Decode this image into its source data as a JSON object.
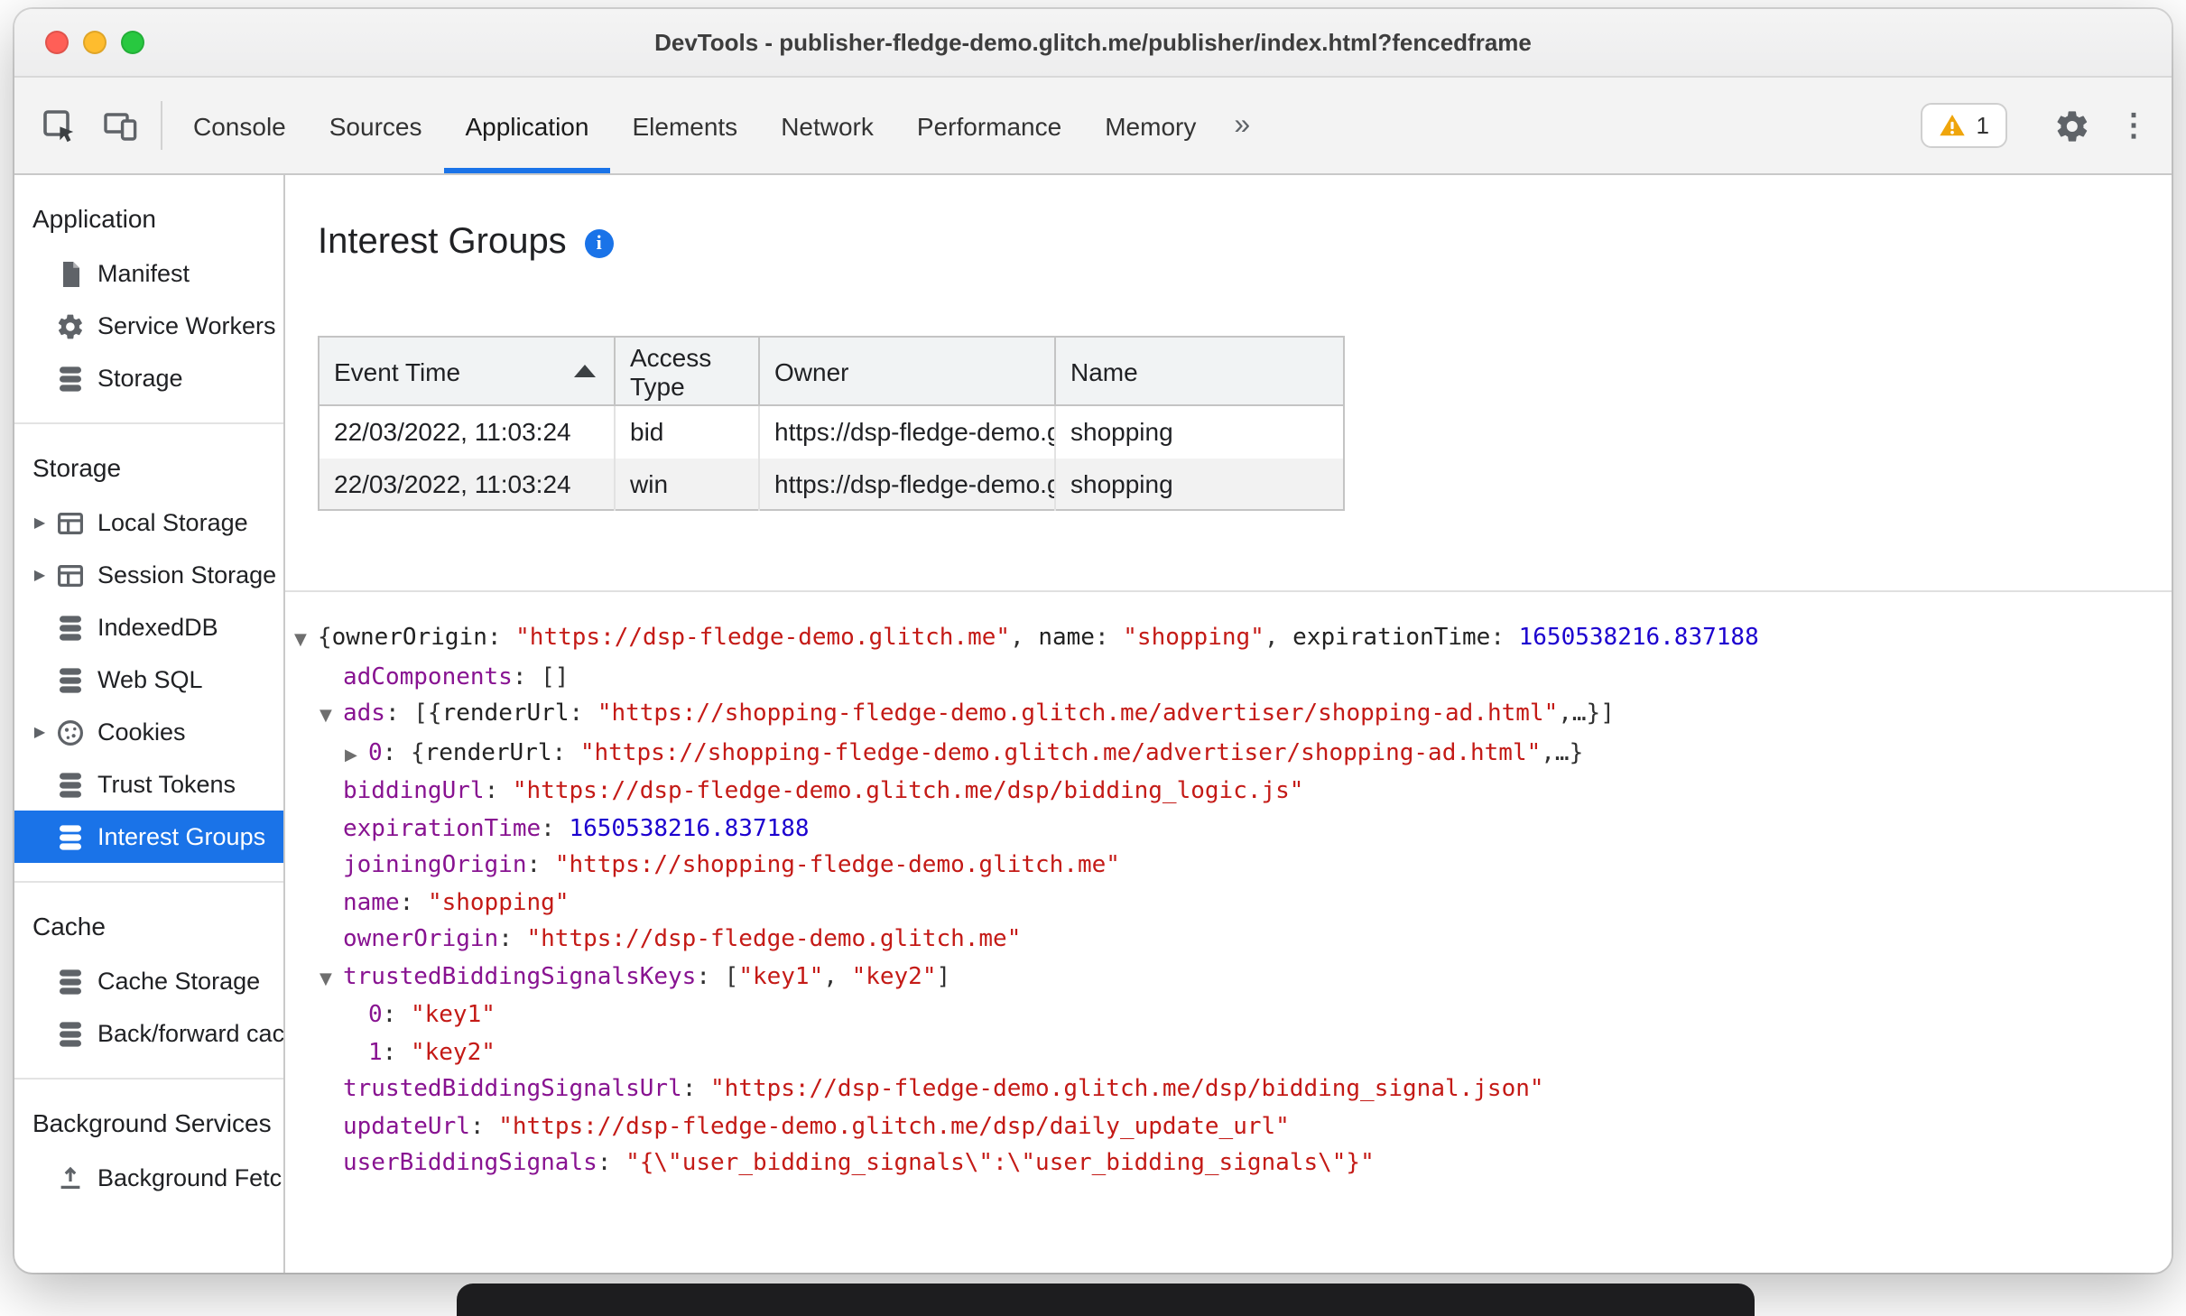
{
  "colors": {
    "accent": "#1a73e8",
    "key": "#881391",
    "string": "#c41a16",
    "number": "#1c00cf",
    "warning": "#efa50b"
  },
  "window": {
    "title": "DevTools - publisher-fledge-demo.glitch.me/publisher/index.html?fencedframe"
  },
  "toolbar": {
    "tabs": [
      {
        "label": "Console"
      },
      {
        "label": "Sources"
      },
      {
        "label": "Application",
        "active": true
      },
      {
        "label": "Elements"
      },
      {
        "label": "Network"
      },
      {
        "label": "Performance"
      },
      {
        "label": "Memory"
      }
    ],
    "more_tabs_symbol": "»",
    "warning_count": "1",
    "overflow_menu_symbol": "⋮"
  },
  "sidebar": {
    "sections": [
      {
        "title": "Application",
        "items": [
          {
            "label": "Manifest",
            "icon": "manifest-document-icon"
          },
          {
            "label": "Service Workers",
            "icon": "service-worker-gear-icon"
          },
          {
            "label": "Storage",
            "icon": "database-stack-icon"
          }
        ]
      },
      {
        "title": "Storage",
        "items": [
          {
            "label": "Local Storage",
            "icon": "table-grid-icon",
            "expandable": true
          },
          {
            "label": "Session Storage",
            "icon": "table-grid-icon",
            "expandable": true
          },
          {
            "label": "IndexedDB",
            "icon": "database-stack-icon"
          },
          {
            "label": "Web SQL",
            "icon": "database-stack-icon"
          },
          {
            "label": "Cookies",
            "icon": "cookie-icon",
            "expandable": true
          },
          {
            "label": "Trust Tokens",
            "icon": "database-stack-icon"
          },
          {
            "label": "Interest Groups",
            "icon": "database-stack-icon",
            "selected": true
          }
        ]
      },
      {
        "title": "Cache",
        "items": [
          {
            "label": "Cache Storage",
            "icon": "database-stack-icon"
          },
          {
            "label": "Back/forward cache",
            "icon": "database-stack-icon"
          }
        ]
      },
      {
        "title": "Background Services",
        "items": [
          {
            "label": "Background Fetch",
            "icon": "background-fetch-icon"
          }
        ]
      }
    ]
  },
  "main": {
    "heading": "Interest Groups",
    "table": {
      "columns": [
        "Event Time",
        "Access Type",
        "Owner",
        "Name"
      ],
      "sort_column": "Event Time",
      "sort_direction": "ascending",
      "rows": [
        [
          "22/03/2022, 11:03:24",
          "bid",
          "https://dsp-fledge-demo.gl…",
          "shopping"
        ],
        [
          "22/03/2022, 11:03:24",
          "win",
          "https://dsp-fledge-demo.gl…",
          "shopping"
        ]
      ]
    },
    "tree": {
      "lines": [
        {
          "level": 0,
          "expander": "expanded",
          "segments": [
            {
              "type": "punct",
              "text": "{"
            },
            {
              "type": "preview-key",
              "text": "ownerOrigin"
            },
            {
              "type": "punct",
              "text": ": "
            },
            {
              "type": "string",
              "text": "\"https://dsp-fledge-demo.glitch.me\""
            },
            {
              "type": "punct",
              "text": ", "
            },
            {
              "type": "preview-key",
              "text": "name"
            },
            {
              "type": "punct",
              "text": ": "
            },
            {
              "type": "string",
              "text": "\"shopping\""
            },
            {
              "type": "punct",
              "text": ", "
            },
            {
              "type": "preview-key",
              "text": "expirationTime"
            },
            {
              "type": "punct",
              "text": ": "
            },
            {
              "type": "number",
              "text": "1650538216.837188"
            }
          ]
        },
        {
          "level": 1,
          "segments": [
            {
              "type": "key",
              "text": "adComponents"
            },
            {
              "type": "punct",
              "text": ": []"
            }
          ]
        },
        {
          "level": 1,
          "expander": "expanded",
          "segments": [
            {
              "type": "key",
              "text": "ads"
            },
            {
              "type": "punct",
              "text": ": [{"
            },
            {
              "type": "preview-key",
              "text": "renderUrl"
            },
            {
              "type": "punct",
              "text": ": "
            },
            {
              "type": "string",
              "text": "\"https://shopping-fledge-demo.glitch.me/advertiser/shopping-ad.html\""
            },
            {
              "type": "punct",
              "text": ",…}]"
            }
          ]
        },
        {
          "level": 2,
          "expander": "collapsed",
          "segments": [
            {
              "type": "key",
              "text": "0"
            },
            {
              "type": "punct",
              "text": ": {"
            },
            {
              "type": "preview-key",
              "text": "renderUrl"
            },
            {
              "type": "punct",
              "text": ": "
            },
            {
              "type": "string",
              "text": "\"https://shopping-fledge-demo.glitch.me/advertiser/shopping-ad.html\""
            },
            {
              "type": "punct",
              "text": ",…}"
            }
          ]
        },
        {
          "level": 1,
          "segments": [
            {
              "type": "key",
              "text": "biddingUrl"
            },
            {
              "type": "punct",
              "text": ": "
            },
            {
              "type": "string",
              "text": "\"https://dsp-fledge-demo.glitch.me/dsp/bidding_logic.js\""
            }
          ]
        },
        {
          "level": 1,
          "segments": [
            {
              "type": "key",
              "text": "expirationTime"
            },
            {
              "type": "punct",
              "text": ": "
            },
            {
              "type": "number",
              "text": "1650538216.837188"
            }
          ]
        },
        {
          "level": 1,
          "segments": [
            {
              "type": "key",
              "text": "joiningOrigin"
            },
            {
              "type": "punct",
              "text": ": "
            },
            {
              "type": "string",
              "text": "\"https://shopping-fledge-demo.glitch.me\""
            }
          ]
        },
        {
          "level": 1,
          "segments": [
            {
              "type": "key",
              "text": "name"
            },
            {
              "type": "punct",
              "text": ": "
            },
            {
              "type": "string",
              "text": "\"shopping\""
            }
          ]
        },
        {
          "level": 1,
          "segments": [
            {
              "type": "key",
              "text": "ownerOrigin"
            },
            {
              "type": "punct",
              "text": ": "
            },
            {
              "type": "string",
              "text": "\"https://dsp-fledge-demo.glitch.me\""
            }
          ]
        },
        {
          "level": 1,
          "expander": "expanded",
          "segments": [
            {
              "type": "key",
              "text": "trustedBiddingSignalsKeys"
            },
            {
              "type": "punct",
              "text": ": ["
            },
            {
              "type": "string",
              "text": "\"key1\""
            },
            {
              "type": "punct",
              "text": ", "
            },
            {
              "type": "string",
              "text": "\"key2\""
            },
            {
              "type": "punct",
              "text": "]"
            }
          ]
        },
        {
          "level": 2,
          "segments": [
            {
              "type": "key",
              "text": "0"
            },
            {
              "type": "punct",
              "text": ": "
            },
            {
              "type": "string",
              "text": "\"key1\""
            }
          ]
        },
        {
          "level": 2,
          "segments": [
            {
              "type": "key",
              "text": "1"
            },
            {
              "type": "punct",
              "text": ": "
            },
            {
              "type": "string",
              "text": "\"key2\""
            }
          ]
        },
        {
          "level": 1,
          "segments": [
            {
              "type": "key",
              "text": "trustedBiddingSignalsUrl"
            },
            {
              "type": "punct",
              "text": ": "
            },
            {
              "type": "string",
              "text": "\"https://dsp-fledge-demo.glitch.me/dsp/bidding_signal.json\""
            }
          ]
        },
        {
          "level": 1,
          "segments": [
            {
              "type": "key",
              "text": "updateUrl"
            },
            {
              "type": "punct",
              "text": ": "
            },
            {
              "type": "string",
              "text": "\"https://dsp-fledge-demo.glitch.me/dsp/daily_update_url\""
            }
          ]
        },
        {
          "level": 1,
          "segments": [
            {
              "type": "key",
              "text": "userBiddingSignals"
            },
            {
              "type": "punct",
              "text": ": "
            },
            {
              "type": "string",
              "text": "\"{\\\"user_bidding_signals\\\":\\\"user_bidding_signals\\\"}\""
            }
          ]
        }
      ]
    }
  }
}
